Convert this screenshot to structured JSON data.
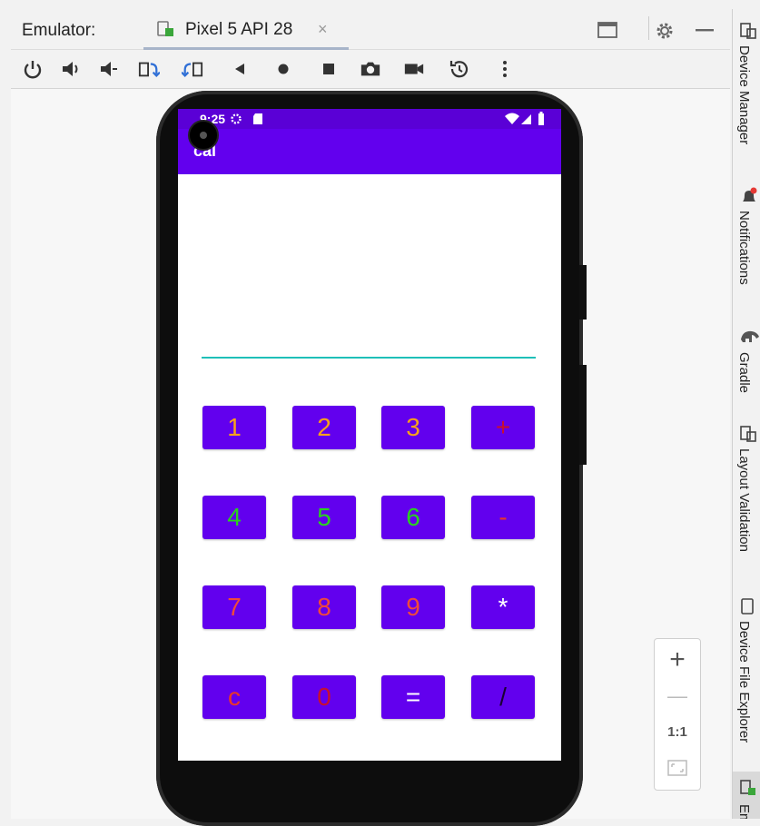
{
  "tabbar": {
    "emulator_label": "Emulator:",
    "tab_title": "Pixel 5 API 28",
    "close_glyph": "×"
  },
  "toolbar": {
    "icons": [
      "power-icon",
      "volume-up-icon",
      "volume-down-icon",
      "rotate-left-icon",
      "rotate-right-icon",
      "back-icon",
      "home-icon",
      "overview-icon",
      "camera-icon",
      "record-icon",
      "snapshot-icon",
      "more-icon"
    ]
  },
  "phone": {
    "status_time": "9:25",
    "app_title": "cal",
    "colors": {
      "statusbar": "#5a00d6",
      "appbar": "#6200ee",
      "button": "#6200ee",
      "underline": "#1fbfb8"
    },
    "buttons": [
      {
        "label": "1",
        "color": "#f7a21b"
      },
      {
        "label": "2",
        "color": "#f7a21b"
      },
      {
        "label": "3",
        "color": "#f7a21b"
      },
      {
        "label": "+",
        "color": "#c8102e"
      },
      {
        "label": "4",
        "color": "#2ad11f"
      },
      {
        "label": "5",
        "color": "#2ad11f"
      },
      {
        "label": "6",
        "color": "#2ad11f"
      },
      {
        "label": "-",
        "color": "#e8362a"
      },
      {
        "label": "7",
        "color": "#f04a3a"
      },
      {
        "label": "8",
        "color": "#f04a3a"
      },
      {
        "label": "9",
        "color": "#f04a3a"
      },
      {
        "label": "*",
        "color": "#ffffff"
      },
      {
        "label": "c",
        "color": "#e8362a"
      },
      {
        "label": "0",
        "color": "#c8102e"
      },
      {
        "label": "=",
        "color": "#ffffff"
      },
      {
        "label": "/",
        "color": "#1a0033"
      }
    ]
  },
  "sidebar": {
    "tabs": [
      {
        "label": "Device Manager"
      },
      {
        "label": "Notifications"
      },
      {
        "label": "Gradle"
      },
      {
        "label": "Layout Validation"
      },
      {
        "label": "Device File Explorer"
      },
      {
        "label": "Em"
      }
    ]
  },
  "zoom": {
    "plus": "+",
    "minus": "—",
    "one_to_one": "1:1"
  }
}
